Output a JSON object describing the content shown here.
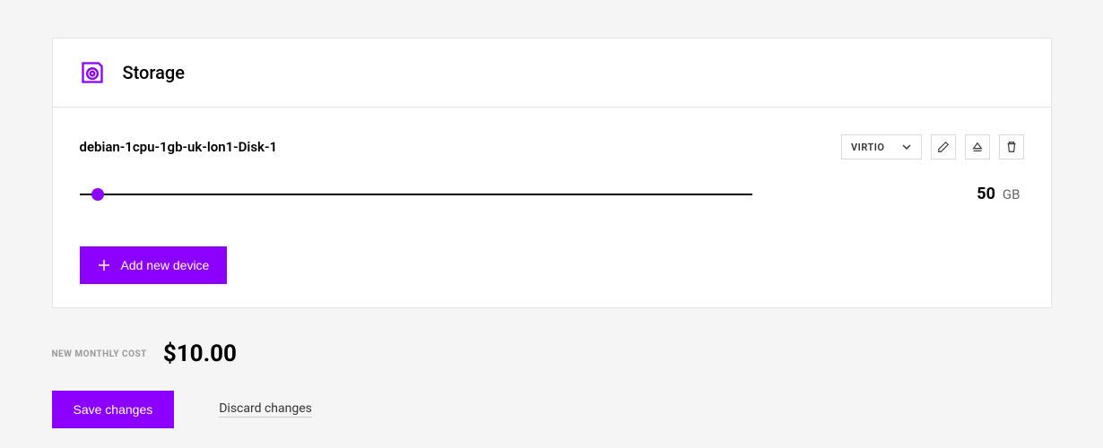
{
  "header": {
    "title": "Storage"
  },
  "disk": {
    "name": "debian-1cpu-1gb-uk-lon1-Disk-1",
    "bus_type": "VIRTIO",
    "size_value": "50",
    "size_unit": "GB"
  },
  "actions": {
    "add_device": "Add new device",
    "save": "Save changes",
    "discard": "Discard changes"
  },
  "cost": {
    "label": "NEW MONTHLY COST",
    "value": "$10.00"
  }
}
